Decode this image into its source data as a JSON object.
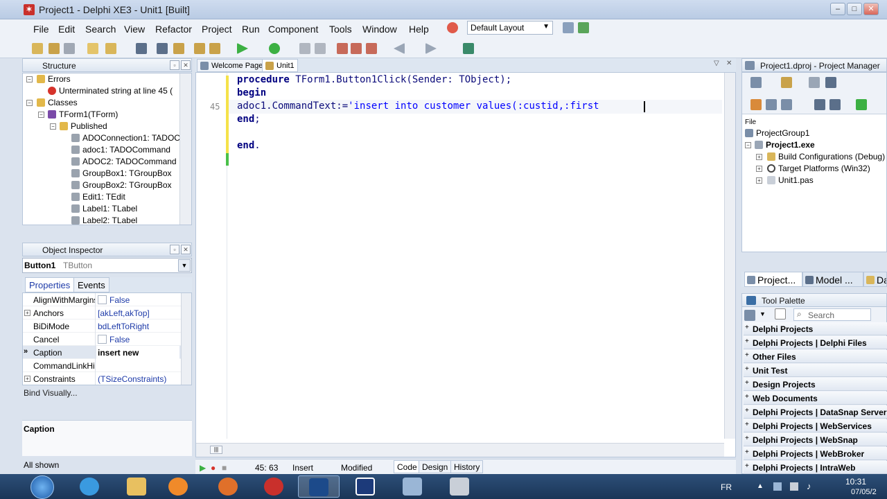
{
  "window": {
    "title": "Project1 - Delphi XE3 - Unit1 [Built]",
    "minimize": "–",
    "maximize": "□",
    "close": "✕"
  },
  "menu": [
    "File",
    "Edit",
    "Search",
    "View",
    "Refactor",
    "Project",
    "Run",
    "Component",
    "Tools",
    "Window",
    "Help"
  ],
  "layout_combo": "Default Layout",
  "structure": {
    "title": "Structure",
    "items": [
      {
        "label": "Errors"
      },
      {
        "label": "Unterminated string at line 45 ("
      },
      {
        "label": "Classes"
      },
      {
        "label": "TForm1(TForm)"
      },
      {
        "label": "Published"
      },
      {
        "label": "ADOConnection1: TADOC"
      },
      {
        "label": "adoc1: TADOCommand"
      },
      {
        "label": "ADOC2: TADOCommand"
      },
      {
        "label": "GroupBox1: TGroupBox"
      },
      {
        "label": "GroupBox2: TGroupBox"
      },
      {
        "label": "Edit1: TEdit"
      },
      {
        "label": "Label1: TLabel"
      },
      {
        "label": "Label2: TLabel"
      }
    ]
  },
  "object_inspector": {
    "title": "Object Inspector",
    "object": "Button1",
    "class": "TButton",
    "tabs": [
      "Properties",
      "Events"
    ],
    "properties": [
      {
        "name": "AlignWithMargins",
        "value": "False"
      },
      {
        "name": "Anchors",
        "value": "[akLeft,akTop]"
      },
      {
        "name": "BiDiMode",
        "value": "bdLeftToRight"
      },
      {
        "name": "Cancel",
        "value": "False"
      },
      {
        "name": "Caption",
        "value": "insert new"
      },
      {
        "name": "CommandLinkHint",
        "value": ""
      },
      {
        "name": "Constraints",
        "value": "(TSizeConstraints)"
      }
    ],
    "bind_visually": "Bind Visually...",
    "description_title": "Caption",
    "filter": "All shown"
  },
  "editor": {
    "tabs": [
      "Welcome Page",
      "Unit1"
    ],
    "line_number": "45",
    "lines": {
      "l1_kw": "procedure",
      "l1_rest": " TForm1.Button1Click(Sender: TObject);",
      "l2_kw": "begin",
      "l3_code": "adoc1.CommandText:=",
      "l3_str": "'insert into customer values(:custid,:first",
      "l4_kw": "end",
      "l4_rest": ";",
      "l5_kw": "end",
      "l5_rest": "."
    },
    "status": {
      "position": "45: 63",
      "mode": "Insert",
      "modified": "Modified",
      "views": [
        "Code",
        "Design",
        "History"
      ]
    }
  },
  "project_manager": {
    "title": "Project1.dproj - Project Manager",
    "file_label": "File",
    "items": [
      {
        "label": "ProjectGroup1"
      },
      {
        "label": "Project1.exe"
      },
      {
        "label": "Build Configurations (Debug)"
      },
      {
        "label": "Target Platforms (Win32)"
      },
      {
        "label": "Unit1.pas"
      }
    ]
  },
  "bottom_tabs": [
    "Project...",
    "Model ...",
    "Da"
  ],
  "tool_palette": {
    "title": "Tool Palette",
    "search_placeholder": "Search",
    "categories": [
      "Delphi Projects",
      "Delphi Projects | Delphi Files",
      "Other Files",
      "Unit Test",
      "Design Projects",
      "Web Documents",
      "Delphi Projects | DataSnap Server",
      "Delphi Projects | WebServices",
      "Delphi Projects | WebSnap",
      "Delphi Projects | WebBroker",
      "Delphi Projects | IntraWeb"
    ]
  },
  "taskbar": {
    "language": "FR",
    "time": "10:31",
    "date": "07/05/2"
  },
  "colors": {
    "keyword": "#000080",
    "string": "#0000ff",
    "accent": "#3a6ea5"
  }
}
